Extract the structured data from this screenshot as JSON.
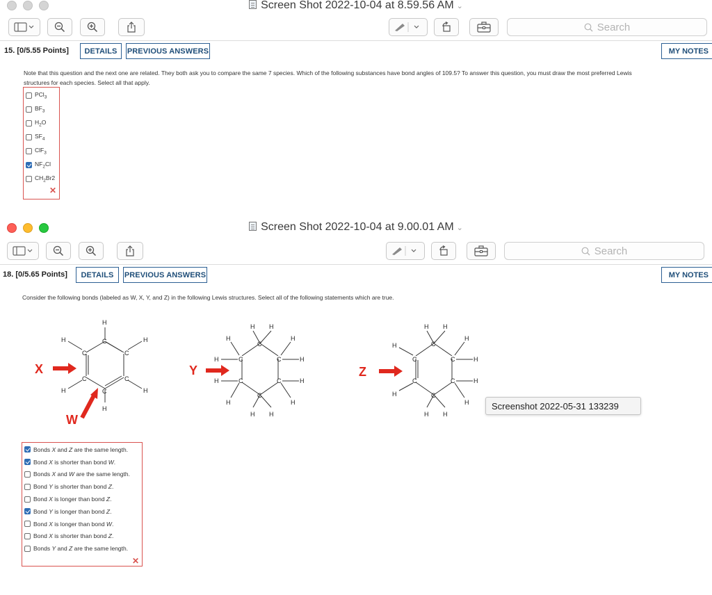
{
  "window1": {
    "title": "Screen Shot 2022-10-04 at 8.59.56 AM",
    "search_placeholder": "Search",
    "question": {
      "number": "15.",
      "points": "[0/5.55 Points]",
      "details_label": "DETAILS",
      "previous_label": "PREVIOUS ANSWERS",
      "notes_label": "MY NOTES",
      "text_line1": "Note that this question and the next one are related. They both ask you to compare the same 7 species. Which of the following substances have bond angles of 109.5? To answer this question, you must draw the most preferred Lewis",
      "text_line2": "structures for each species. Select all that apply.",
      "options": [
        {
          "pre": "PCl",
          "sub": "3",
          "post": "",
          "checked": false
        },
        {
          "pre": "BF",
          "sub": "3",
          "post": "",
          "checked": false
        },
        {
          "pre": "H",
          "sub": "2",
          "post": "O",
          "checked": false
        },
        {
          "pre": "SF",
          "sub": "4",
          "post": "",
          "checked": false
        },
        {
          "pre": "ClF",
          "sub": "3",
          "post": "",
          "checked": false
        },
        {
          "pre": "NF",
          "sub": "2",
          "post": "Cl",
          "checked": true
        },
        {
          "pre": "CH",
          "sub": "2",
          "post": "Br2",
          "checked": false
        }
      ],
      "wrong_mark": "✕"
    }
  },
  "window2": {
    "title": "Screen Shot 2022-10-04 at 9.00.01 AM",
    "search_placeholder": "Search",
    "tooltip": "Screenshot 2022-05-31 133239",
    "question": {
      "number": "18.",
      "points": "[0/5.65 Points]",
      "details_label": "DETAILS",
      "previous_label": "PREVIOUS ANSWERS",
      "notes_label": "MY NOTES",
      "text": "Consider the following bonds (labeled as W, X, Y, and Z) in the following Lewis structures. Select all of the following statements which are true.",
      "labels": {
        "x": "X",
        "y": "Y",
        "z": "Z",
        "w": "W"
      },
      "atoms": {
        "h": "H",
        "c": "C"
      },
      "options": [
        {
          "a": "Bonds ",
          "b": "X",
          "c": " and ",
          "d": "Z",
          "e": " are the same length.",
          "checked": true
        },
        {
          "a": "Bond ",
          "b": "X",
          "c": " is shorter than bond ",
          "d": "W",
          "e": ".",
          "checked": true
        },
        {
          "a": "Bonds ",
          "b": "X",
          "c": " and ",
          "d": "W",
          "e": " are the same length.",
          "checked": false
        },
        {
          "a": "Bond ",
          "b": "Y",
          "c": " is shorter than bond ",
          "d": "Z",
          "e": ".",
          "checked": false
        },
        {
          "a": "Bond ",
          "b": "X",
          "c": " is longer than bond ",
          "d": "Z",
          "e": ".",
          "checked": false
        },
        {
          "a": "Bond ",
          "b": "Y",
          "c": " is longer than bond ",
          "d": "Z",
          "e": ".",
          "checked": true
        },
        {
          "a": "Bond ",
          "b": "X",
          "c": " is longer than bond ",
          "d": "W",
          "e": ".",
          "checked": false
        },
        {
          "a": "Bond ",
          "b": "X",
          "c": " is shorter than bond ",
          "d": "Z",
          "e": ".",
          "checked": false
        },
        {
          "a": "Bonds ",
          "b": "Y",
          "c": " and ",
          "d": "Z",
          "e": " are the same length.",
          "checked": false
        }
      ],
      "wrong_mark": "✕"
    }
  },
  "colors": {
    "accent": "#1f4e79",
    "error": "#d9534f",
    "arrow": "#e0281e",
    "check": "#2f6db5"
  },
  "icons": [
    "sidebar-icon",
    "zoom-out-icon",
    "zoom-in-icon",
    "share-icon",
    "markup-icon",
    "rotate-icon",
    "toolbox-icon",
    "search-icon",
    "document-icon"
  ]
}
